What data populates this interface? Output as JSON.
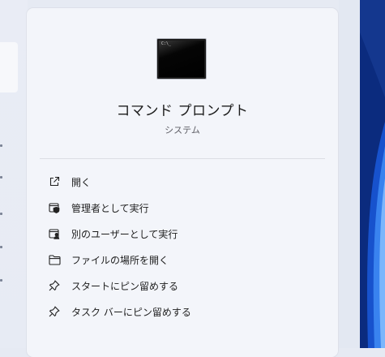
{
  "app": {
    "title": "コマンド プロンプト",
    "subtitle": "システム",
    "icon": "command-prompt-icon"
  },
  "actions": [
    {
      "label": "開く",
      "icon": "open-external-icon"
    },
    {
      "label": "管理者として実行",
      "icon": "run-as-admin-icon"
    },
    {
      "label": "別のユーザーとして実行",
      "icon": "run-as-other-user-icon"
    },
    {
      "label": "ファイルの場所を開く",
      "icon": "folder-icon"
    },
    {
      "label": "スタートにピン留めする",
      "icon": "pin-icon"
    },
    {
      "label": "タスク バーにピン留めする",
      "icon": "pin-icon"
    }
  ],
  "colors": {
    "panel": "#f3f5fa",
    "wallpaper": "#0a2a7a",
    "text": "#1e1e1e"
  }
}
